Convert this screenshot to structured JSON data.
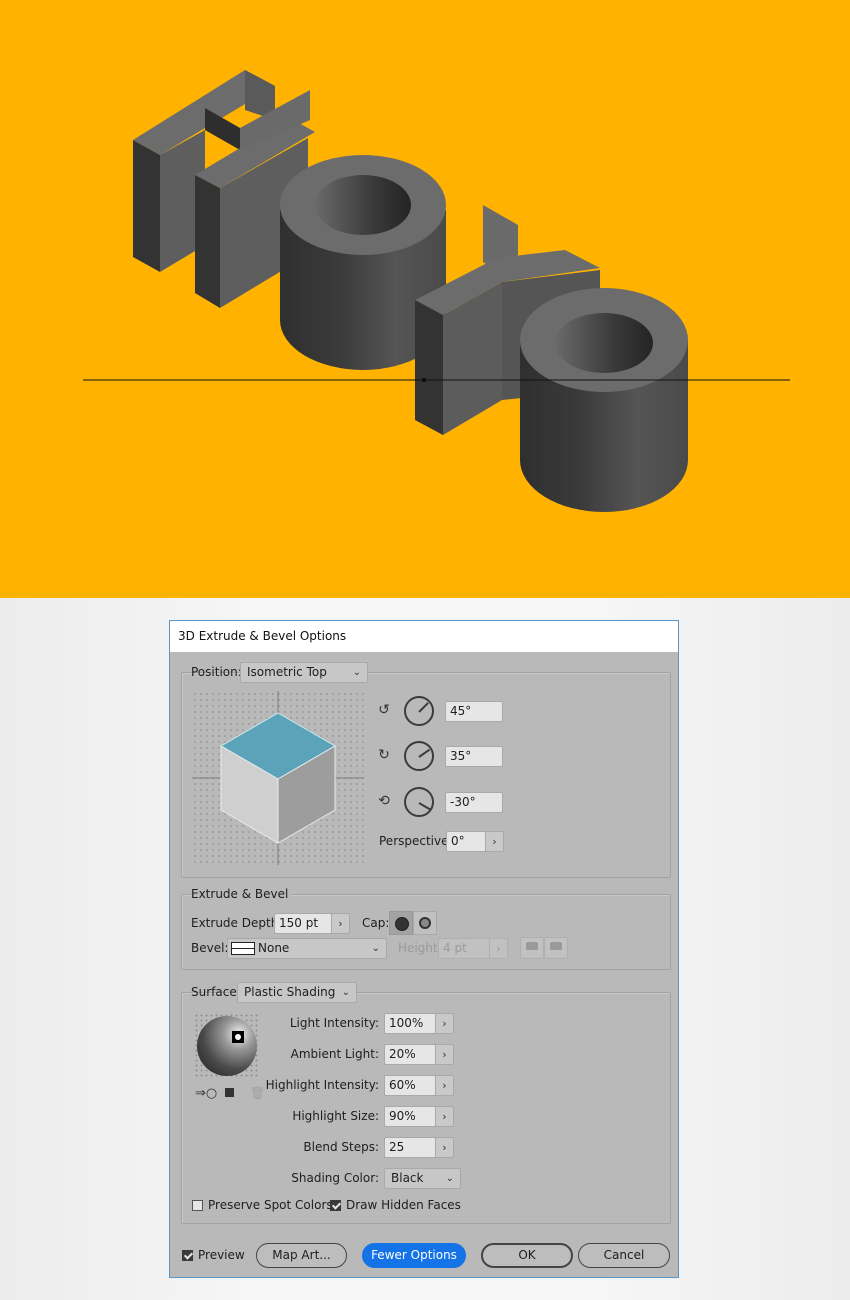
{
  "artwork": {
    "text": "HOYO",
    "background_color": "#ffb300",
    "object_color": "#5e5e5e"
  },
  "dialog": {
    "title": "3D Extrude & Bevel Options",
    "position": {
      "label": "Position:",
      "value": "Isometric Top",
      "rotation_x": "45°",
      "rotation_y": "35°",
      "rotation_z": "-30°",
      "rotation_x_deg": 45,
      "rotation_y_deg": 35,
      "rotation_z_deg": -30,
      "perspective_label": "Perspective:",
      "perspective_value": "0°",
      "cube_top_color": "#5ba3b8"
    },
    "extrude": {
      "group_label": "Extrude & Bevel",
      "depth_label": "Extrude Depth:",
      "depth_value": "150 pt",
      "cap_label": "Cap:",
      "bevel_label": "Bevel:",
      "bevel_value": "None",
      "height_label": "Height:",
      "height_value": "4 pt"
    },
    "surface": {
      "label": "Surface:",
      "value": "Plastic Shading",
      "light_intensity_label": "Light Intensity:",
      "light_intensity_value": "100%",
      "ambient_light_label": "Ambient Light:",
      "ambient_light_value": "20%",
      "highlight_intensity_label": "Highlight Intensity:",
      "highlight_intensity_value": "60%",
      "highlight_size_label": "Highlight Size:",
      "highlight_size_value": "90%",
      "blend_steps_label": "Blend Steps:",
      "blend_steps_value": "25",
      "shading_color_label": "Shading Color:",
      "shading_color_value": "Black",
      "preserve_spot_label": "Preserve Spot Colors",
      "preserve_spot_checked": false,
      "draw_hidden_label": "Draw Hidden Faces",
      "draw_hidden_checked": true
    },
    "footer": {
      "preview_label": "Preview",
      "preview_checked": true,
      "map_art_label": "Map Art...",
      "fewer_options_label": "Fewer Options",
      "ok_label": "OK",
      "cancel_label": "Cancel"
    }
  }
}
